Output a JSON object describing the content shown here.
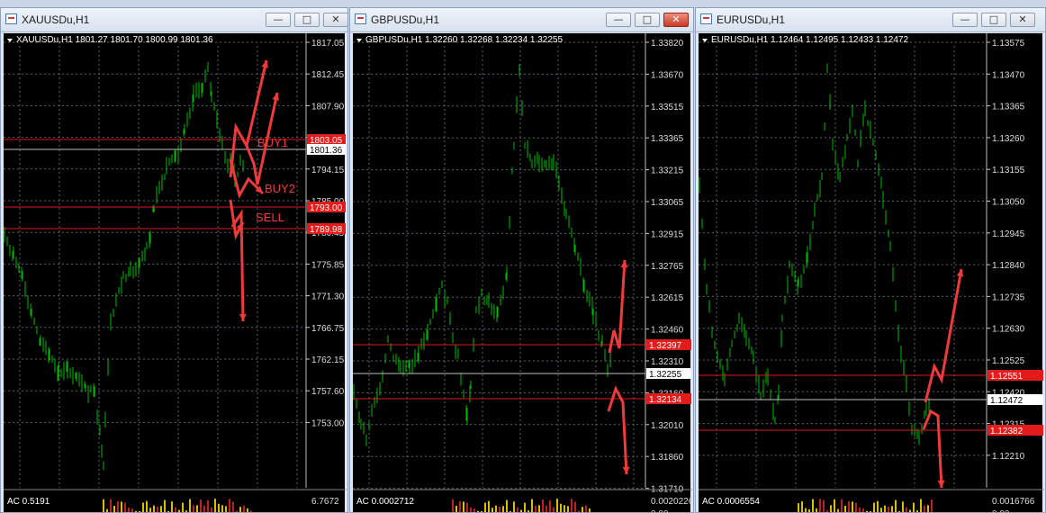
{
  "windows": [
    {
      "id": "xau",
      "title": "XAUUSDu,H1",
      "header": "XAUUSDu,H1  1801.27 1801.70 1800.99 1801.36",
      "price_labels": [
        "1817.05",
        "1812.45",
        "1807.90",
        "1798.75",
        "1794.15",
        "1785.00",
        "1780.45",
        "1775.85",
        "1771.30",
        "1766.75",
        "1762.15",
        "1757.60",
        "1753.00"
      ],
      "levels": [
        {
          "value": "1803.05",
          "kind": "red"
        },
        {
          "value": "1801.36",
          "kind": "current"
        },
        {
          "value": "1793.00",
          "kind": "red"
        },
        {
          "value": "1789.98",
          "kind": "red"
        }
      ],
      "annotations": [
        "BUY1",
        "BUY2",
        "SELL"
      ],
      "indicator": "AC 0.5191",
      "indicator_value": "6.7672"
    },
    {
      "id": "gbp",
      "title": "GBPUSDu,H1",
      "header": "GBPUSDu,H1  1.32260 1.32268 1.32234 1.32255",
      "price_labels": [
        "1.33820",
        "1.33670",
        "1.33515",
        "1.33365",
        "1.33215",
        "1.33065",
        "1.32915",
        "1.32765",
        "1.32615",
        "1.32460",
        "1.32310",
        "1.32160",
        "1.32010",
        "1.31860",
        "1.31710"
      ],
      "levels": [
        {
          "value": "1.32397",
          "kind": "red"
        },
        {
          "value": "1.32255",
          "kind": "current"
        },
        {
          "value": "1.32134",
          "kind": "red"
        }
      ],
      "indicator": "AC 0.0002712",
      "indicator_value": "0.0020226",
      "indicator_zero": "0.00"
    },
    {
      "id": "eur",
      "title": "EURUSDu,H1",
      "header": "EURUSDu,H1  1.12464 1.12495 1.12433 1.12472",
      "price_labels": [
        "1.13575",
        "1.13470",
        "1.13365",
        "1.13260",
        "1.13155",
        "1.13050",
        "1.12945",
        "1.12840",
        "1.12735",
        "1.12630",
        "1.12525",
        "1.12420",
        "1.12315",
        "1.12210"
      ],
      "levels": [
        {
          "value": "1.12551",
          "kind": "red"
        },
        {
          "value": "1.12472",
          "kind": "current"
        },
        {
          "value": "1.12382",
          "kind": "red"
        }
      ],
      "indicator": "AC 0.0006554",
      "indicator_value": "0.0016766",
      "indicator_zero": "0.00"
    }
  ],
  "colors": {
    "candle": "#00c000",
    "grid": "#5a6470",
    "level": "#e01818",
    "arrow": "#f03a3a",
    "current": "#c0c0c0"
  }
}
